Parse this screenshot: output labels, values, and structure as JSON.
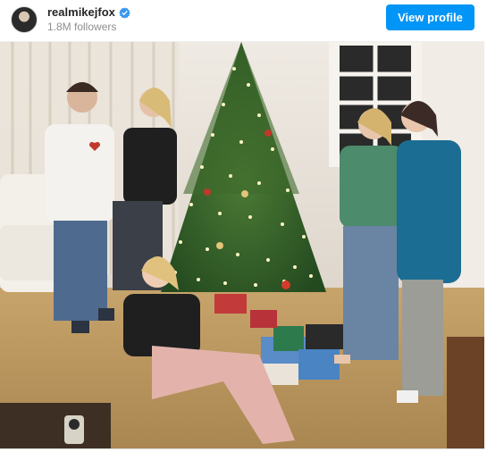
{
  "header": {
    "username": "realmikejfox",
    "followers": "1.8M followers",
    "verified": true,
    "view_profile_label": "View profile"
  },
  "avatar": {
    "icon": "profile-avatar"
  },
  "post": {
    "image": "family-christmas-tree-photo"
  },
  "colors": {
    "button": "#0095f6",
    "username": "#262626",
    "followers": "#8e8e8e",
    "verified": "#3897f0"
  }
}
